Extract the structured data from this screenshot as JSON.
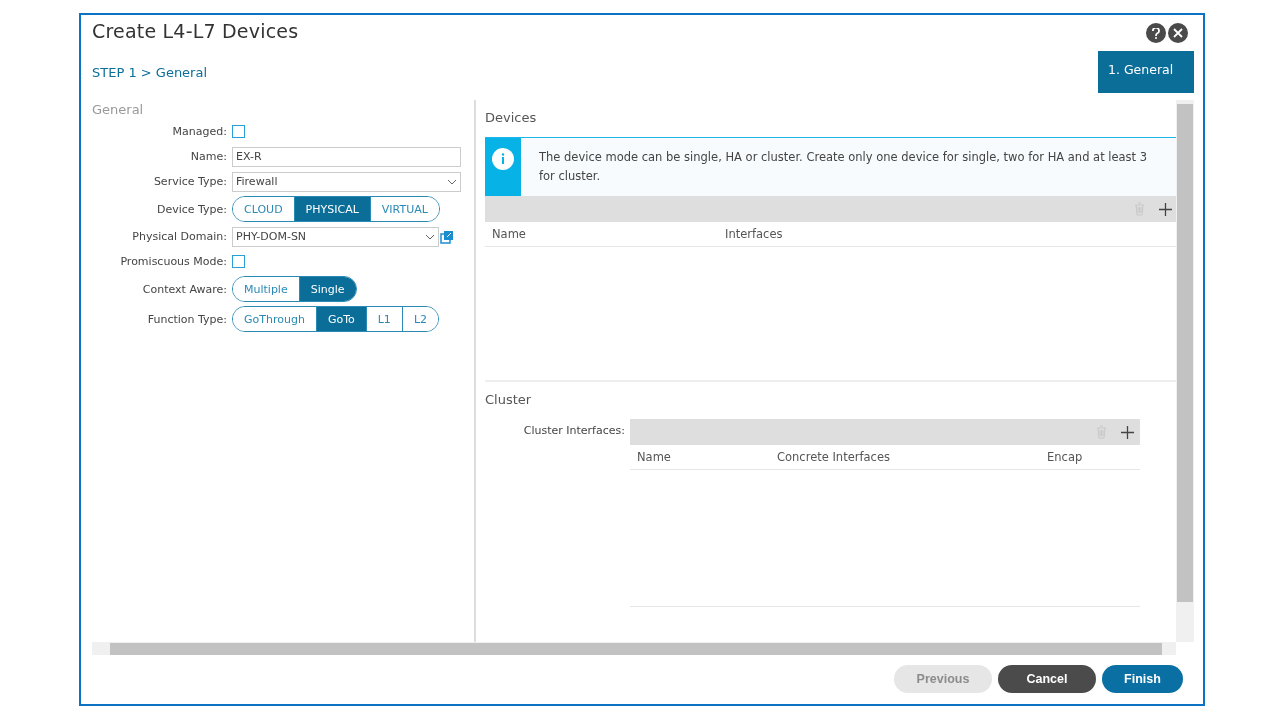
{
  "window": {
    "title": "Create L4-L7 Devices"
  },
  "breadcrumb": "STEP 1 > General",
  "steps": [
    {
      "label": "1. General",
      "selected": true
    }
  ],
  "form": {
    "section": "General",
    "fields": [
      {
        "kind": "checkbox",
        "label": "Managed:",
        "checked": false
      },
      {
        "kind": "text",
        "label": "Name:",
        "value": "EX-R"
      },
      {
        "kind": "select",
        "label": "Service Type:",
        "value": "Firewall"
      },
      {
        "kind": "segmented",
        "label": "Device Type:",
        "options": [
          {
            "label": "CLOUD",
            "selected": false
          },
          {
            "label": "PHYSICAL",
            "selected": true
          },
          {
            "label": "VIRTUAL",
            "selected": false
          }
        ]
      },
      {
        "kind": "select-link",
        "label": "Physical Domain:",
        "value": "PHY-DOM-SN"
      },
      {
        "kind": "checkbox",
        "label": "Promiscuous Mode:",
        "checked": false
      },
      {
        "kind": "segmented",
        "label": "Context Aware:",
        "options": [
          {
            "label": "Multiple",
            "selected": false
          },
          {
            "label": "Single",
            "selected": true
          }
        ]
      },
      {
        "kind": "segmented",
        "label": "Function Type:",
        "options": [
          {
            "label": "GoThrough",
            "selected": false
          },
          {
            "label": "GoTo",
            "selected": true
          },
          {
            "label": "L1",
            "selected": false
          },
          {
            "label": "L2",
            "selected": false
          }
        ]
      }
    ]
  },
  "devices": {
    "title": "Devices",
    "info": "The device mode can be single, HA or cluster. Create only one device for single, two for HA and at least 3 for cluster.",
    "columns": [
      "Name",
      "Interfaces"
    ]
  },
  "cluster": {
    "title": "Cluster",
    "label": "Cluster Interfaces:",
    "columns": [
      "Name",
      "Concrete Interfaces",
      "Encap"
    ]
  },
  "buttons": [
    {
      "label": "Previous",
      "kind": "neutral",
      "disabled": true
    },
    {
      "label": "Cancel",
      "kind": "neutral",
      "disabled": false
    },
    {
      "label": "Finish",
      "kind": "primary",
      "disabled": false
    }
  ]
}
